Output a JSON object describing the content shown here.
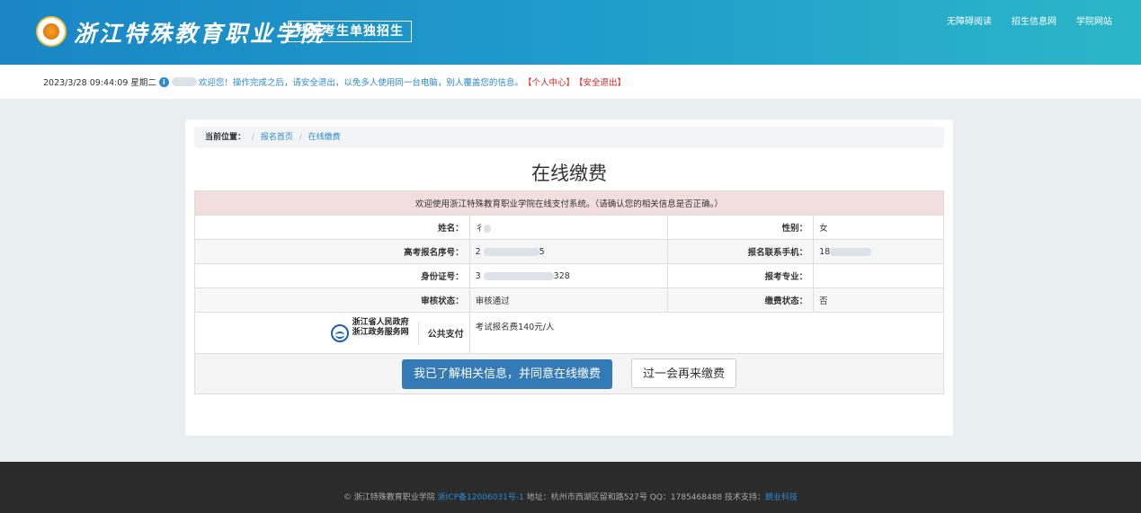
{
  "header": {
    "school_name": "浙江特殊教育职业学院",
    "badge": "残疾考生单独招生",
    "links": [
      "无障碍阅读",
      "招生信息网",
      "学院网站"
    ]
  },
  "infobar": {
    "datetime": "2023/3/28 09:44:09 星期二",
    "message": "欢迎您！操作完成之后，请安全退出，以免多人使用同一台电脑，别人覆盖您的信息。",
    "personal_center": "【个人中心】",
    "logout": "【安全退出】"
  },
  "breadcrumb": {
    "label": "当前位置：",
    "items": [
      "报名首页",
      "在线缴费"
    ]
  },
  "page_title": "在线缴费",
  "table": {
    "notice": "欢迎使用浙江特殊教育职业学院在线支付系统。（请确认您的相关信息是否正确。）",
    "rows": [
      {
        "l1": "姓名：",
        "v1": "彳",
        "l2": "性别：",
        "v2": "女"
      },
      {
        "l1": "高考报名序号：",
        "v1": "2",
        "v1_end": "5",
        "l2": "报名联系手机：",
        "v2": "18"
      },
      {
        "l1": "身份证号：",
        "v1": "3",
        "v1_end": "328",
        "l2": "报考专业：",
        "v2": ""
      },
      {
        "l1": "审核状态：",
        "v1": "审核通过",
        "l2": "缴费状态：",
        "v2": "否"
      }
    ],
    "gov_name_1": "浙江省人民政府",
    "gov_name_2": "浙江政务服务网",
    "pay_label": "公共支付",
    "fee_text": "考试报名费140元/人"
  },
  "buttons": {
    "agree": "我已了解相关信息，并同意在线缴费",
    "later": "过一会再来缴费"
  },
  "footer": {
    "copyright": "© 浙江特殊教育职业学院 ",
    "icp": "浙ICP备12006031号-1",
    "address": " 地址：杭州市西湖区留和路527号 QQ：1785468488 技术支持：",
    "support": "朗业科技"
  }
}
